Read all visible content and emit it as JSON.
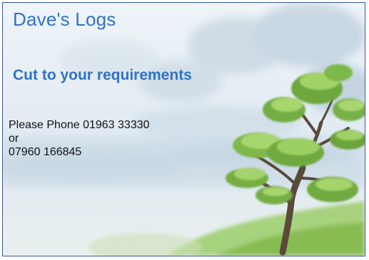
{
  "card": {
    "title": "Dave's Logs",
    "tagline": "Cut to your requirements",
    "phone_line": "Please Phone 01963 33330",
    "or_text": "or",
    "mobile": "07960 166845"
  },
  "colors": {
    "heading_blue": "#2f73c9",
    "border_blue": "#3a57a8",
    "body_text": "#111111",
    "foliage_green": "#7fb84a",
    "trunk_brown": "#5a4a3a"
  },
  "illustration": {
    "subject": "watercolour-tree-landscape"
  }
}
